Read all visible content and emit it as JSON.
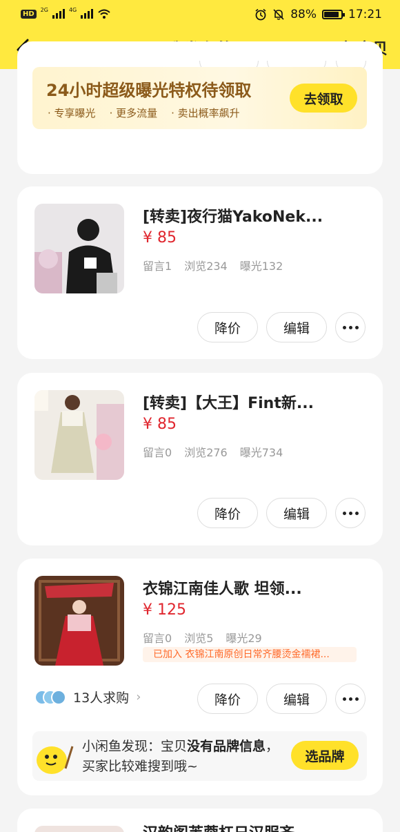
{
  "status_bar": {
    "left_badge": "HD",
    "net1": "2G",
    "net2": "4G",
    "battery_pct": "88%",
    "battery_level": 0.88,
    "time": "17:21"
  },
  "header": {
    "title": "我发布的",
    "action": "下架宝贝"
  },
  "promo": {
    "title": "24小时超级曝光特权待领取",
    "bullets": [
      "专享曝光",
      "更多流量",
      "卖出概率飙升"
    ],
    "button": "去领取"
  },
  "items": [
    {
      "title": "[转卖]夜行猫YakoNek...",
      "price": "¥ 85",
      "comments": "留言1",
      "views": "浏览234",
      "exposure": "曝光132",
      "btn_price": "降价",
      "btn_edit": "编辑"
    },
    {
      "title": "[转卖]【大王】Fint新...",
      "price": "¥ 85",
      "comments": "留言0",
      "views": "浏览276",
      "exposure": "曝光734",
      "btn_price": "降价",
      "btn_edit": "编辑"
    },
    {
      "title": "衣锦江南佳人歌 坦领...",
      "price": "¥ 125",
      "comments": "留言0",
      "views": "浏览5",
      "exposure": "曝光29",
      "tag": "已加入 衣锦江南原创日常齐腰烫金襦裙...",
      "wants": "13人求购",
      "btn_price": "降价",
      "btn_edit": "编辑",
      "tip_normal1": "小闲鱼发现：宝贝",
      "tip_bold1": "没有品牌信息",
      "tip_normal2": "，买家比较难搜到哦~",
      "tip_button": "选品牌"
    },
    {
      "title": "汉韵阁芙蓉杠日汉服齐..."
    }
  ],
  "colors": {
    "brand_yellow": "#ffe93f",
    "price_red": "#e0262e",
    "tag_orange": "#ff6a2a"
  }
}
